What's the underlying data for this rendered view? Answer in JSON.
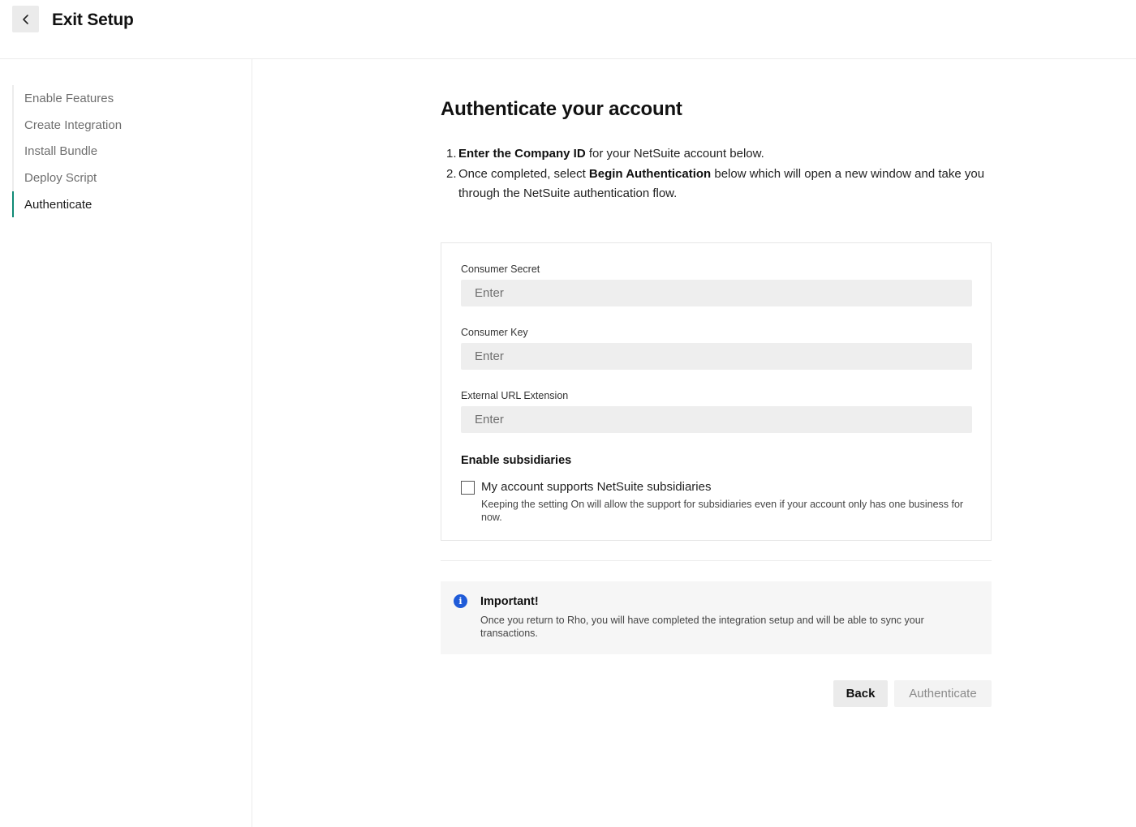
{
  "header": {
    "title": "Exit Setup"
  },
  "sidebar": {
    "steps": [
      {
        "label": "Enable Features"
      },
      {
        "label": "Create Integration"
      },
      {
        "label": "Install Bundle"
      },
      {
        "label": "Deploy Script"
      },
      {
        "label": "Authenticate"
      }
    ],
    "active_step": "Authenticate"
  },
  "main": {
    "title": "Authenticate your account",
    "instructions": [
      {
        "num": "1.",
        "bold": "Enter the Company ID",
        "rest": " for your NetSuite account below."
      },
      {
        "num": "2.",
        "pre": "Once completed, select ",
        "bold": "Begin Authentication",
        "rest": " below which will open a new window and take you through the NetSuite authentication flow."
      }
    ],
    "form": {
      "consumer_secret": {
        "label": "Consumer Secret",
        "placeholder": "Enter",
        "value": ""
      },
      "consumer_key": {
        "label": "Consumer Key",
        "placeholder": "Enter",
        "value": ""
      },
      "external_url": {
        "label": "External URL Extension",
        "placeholder": "Enter",
        "value": ""
      },
      "subsidiaries": {
        "heading": "Enable subsidiaries",
        "checkbox_label": "My account supports NetSuite subsidiaries",
        "checked": false,
        "description": "Keeping the setting On will allow the support for subsidiaries even if your account only has one business for now."
      }
    },
    "notice": {
      "title": "Important!",
      "text": "Once you return to Rho, you will have completed the integration setup and will be able to sync your transactions."
    },
    "actions": {
      "back_label": "Back",
      "authenticate_label": "Authenticate"
    }
  },
  "colors": {
    "accent": "#0f8a75",
    "info": "#1f5bd8",
    "input_bg": "#eeeeee"
  }
}
